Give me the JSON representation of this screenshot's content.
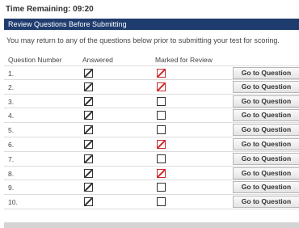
{
  "timer": {
    "label": "Time Remaining:",
    "value": "09:20"
  },
  "section_title": "Review Questions Before Submitting",
  "instructions": "You may return to any of the questions below prior to submitting your test for scoring.",
  "columns": {
    "number": "Question Number",
    "answered": "Answered",
    "marked": "Marked for Review"
  },
  "goto_label": "Go to Question",
  "questions": [
    {
      "number": "1.",
      "answered": true,
      "marked": true
    },
    {
      "number": "2.",
      "answered": true,
      "marked": true
    },
    {
      "number": "3.",
      "answered": true,
      "marked": false
    },
    {
      "number": "4.",
      "answered": true,
      "marked": false
    },
    {
      "number": "5.",
      "answered": true,
      "marked": false
    },
    {
      "number": "6.",
      "answered": true,
      "marked": true
    },
    {
      "number": "7.",
      "answered": true,
      "marked": false
    },
    {
      "number": "8.",
      "answered": true,
      "marked": true
    },
    {
      "number": "9.",
      "answered": true,
      "marked": false
    },
    {
      "number": "10.",
      "answered": true,
      "marked": false
    }
  ],
  "colors": {
    "section_bar": "#1f3c6e",
    "flag": "#cc2a2a",
    "check": "#333333"
  }
}
